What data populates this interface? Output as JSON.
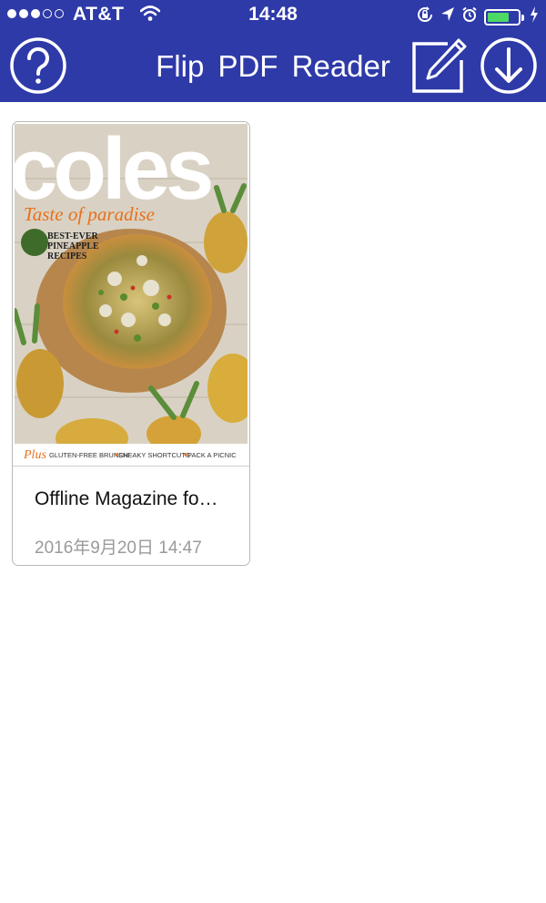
{
  "status_bar": {
    "carrier": "AT&T",
    "time": "14:48",
    "signal_bars": 3,
    "battery_level": 0.75,
    "icons": [
      "signal-dots-icon",
      "wifi-icon",
      "rotation-lock-icon",
      "location-icon",
      "alarm-icon",
      "battery-icon",
      "charging-icon"
    ]
  },
  "nav": {
    "title": "Flip PDF Reader",
    "left_button_icon": "help-icon",
    "right_button_icons": [
      "edit-icon",
      "download-icon"
    ]
  },
  "documents": [
    {
      "title": "Offline Magazine fo…",
      "date": "2016年9月20日 14:47",
      "cover": {
        "brand": "coles",
        "headline": "Taste of paradise",
        "subhead_lines": [
          "BEST-EVER",
          "PINEAPPLE",
          "RECIPES"
        ],
        "footer_lead": "Plus",
        "footer_items": [
          "GLUTEN-FREE BRUNCH",
          "SNEAKY SHORTCUTS",
          "PACK A PICNIC"
        ]
      }
    }
  ],
  "colors": {
    "nav_bar": "#2E3AA8",
    "nav_foreground": "#FFFFFF",
    "battery_fill": "#4CD964",
    "date_text": "#9A9A9A",
    "cover_accent": "#E8701A"
  }
}
